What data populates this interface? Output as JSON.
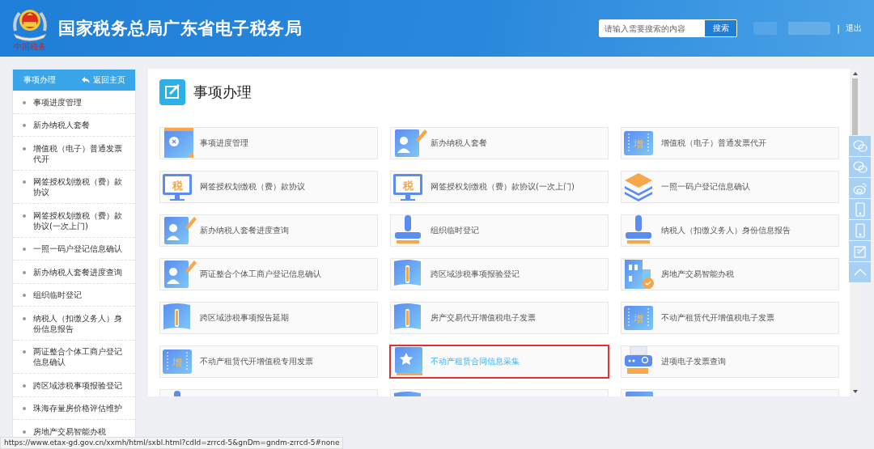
{
  "header": {
    "logo_caption": "中国税务",
    "title": "国家税务总局广东省电子税务局",
    "search": {
      "placeholder": "请输入需要搜索的内容",
      "button": "搜索"
    },
    "separator": "|",
    "logout": "退出"
  },
  "sidebar": {
    "title": "事项办理",
    "back_link": "返回主页",
    "items": [
      {
        "label": "事项进度管理"
      },
      {
        "label": "新办纳税人套餐"
      },
      {
        "label": "增值税（电子）普通发票代开"
      },
      {
        "label": "网签授权划缴税（费）款协议"
      },
      {
        "label": "网签授权划缴税（费）款协议(一次上门)"
      },
      {
        "label": "一照一码户登记信息确认"
      },
      {
        "label": "新办纳税人套餐进度查询"
      },
      {
        "label": "组织临时登记"
      },
      {
        "label": "纳税人（扣缴义务人）身份信息报告"
      },
      {
        "label": "两证整合个体工商户登记信息确认"
      },
      {
        "label": "跨区域涉税事项报验登记"
      },
      {
        "label": "珠海存量房价格评估维护"
      },
      {
        "label": "房地产交易智能办税"
      }
    ]
  },
  "main": {
    "title": "事项办理",
    "cards": [
      {
        "kind": "clipboard",
        "label": "事项进度管理",
        "selected": false
      },
      {
        "kind": "person",
        "label": "新办纳税人套餐",
        "selected": false
      },
      {
        "kind": "ticket",
        "glyph": "增",
        "label": "增值税（电子）普通发票代开",
        "selected": false
      },
      {
        "kind": "monitor",
        "glyph": "税",
        "label": "网签授权划缴税（费）款协议",
        "selected": false
      },
      {
        "kind": "monitor",
        "glyph": "税",
        "label": "网签授权划缴税（费）款协议(一次上门)",
        "selected": false
      },
      {
        "kind": "layers",
        "label": "一照一码户登记信息确认",
        "selected": false
      },
      {
        "kind": "person",
        "label": "新办纳税人套餐进度查询",
        "selected": false
      },
      {
        "kind": "stamp",
        "label": "组织临时登记",
        "selected": false
      },
      {
        "kind": "stamp",
        "label": "纳税人（扣缴义务人）身份信息报告",
        "selected": false
      },
      {
        "kind": "person",
        "label": "两证整合个体工商户登记信息确认",
        "selected": false
      },
      {
        "kind": "book",
        "label": "跨区域涉税事项报验登记",
        "selected": false
      },
      {
        "kind": "building",
        "label": "房地产交易智能办税",
        "selected": false
      },
      {
        "kind": "book",
        "label": "跨区域涉税事项报告延期",
        "selected": false
      },
      {
        "kind": "book",
        "label": "房产交易代开增值税电子发票",
        "selected": false
      },
      {
        "kind": "ticket",
        "glyph": "增",
        "label": "不动产租赁代开增值税电子发票",
        "selected": false
      },
      {
        "kind": "ticket",
        "glyph": "增",
        "label": "不动产租赁代开增值税专用发票",
        "selected": false
      },
      {
        "kind": "starbook",
        "label": "不动产租赁合同信息采集",
        "selected": true
      },
      {
        "kind": "printer",
        "label": "进项电子发票查询",
        "selected": false
      },
      {
        "kind": "stamp",
        "selected": false
      },
      {
        "kind": "book",
        "selected": false
      },
      {
        "kind": "starbook",
        "selected": false
      }
    ]
  },
  "float_tools": [
    {
      "kind": "chat"
    },
    {
      "kind": "chat"
    },
    {
      "kind": "weibo"
    },
    {
      "kind": "phone"
    },
    {
      "kind": "phone"
    },
    {
      "kind": "edit"
    },
    {
      "kind": "up"
    }
  ],
  "status_bar": {
    "url": "https://www.etax-gd.gov.cn/xxmh/html/sxbl.html?cdId=zrrcd-5&gnDm=gndm-zrrcd-5#none"
  }
}
